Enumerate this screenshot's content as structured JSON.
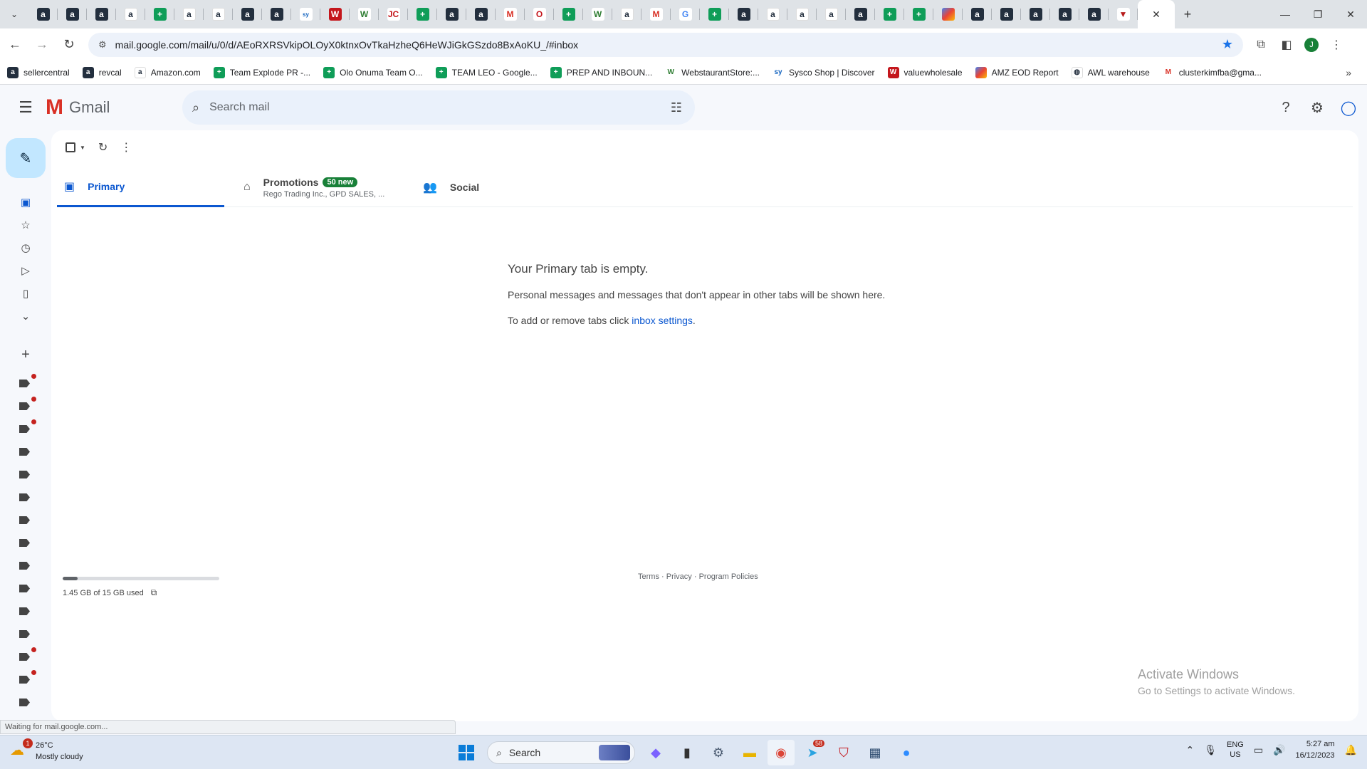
{
  "browser": {
    "tabs": [
      {
        "icon": "amazon-dark-icon",
        "glyph": "a",
        "style": "fav-amzd"
      },
      {
        "icon": "amazon-dark-icon",
        "glyph": "a",
        "style": "fav-amzd"
      },
      {
        "icon": "amazon-dark-icon",
        "glyph": "a",
        "style": "fav-amzd"
      },
      {
        "icon": "amazon-icon",
        "glyph": "a",
        "style": "fav-amz"
      },
      {
        "icon": "sheets-icon",
        "glyph": "+",
        "style": "fav-sheet"
      },
      {
        "icon": "amazon-icon",
        "glyph": "a",
        "style": "fav-amz"
      },
      {
        "icon": "amazon-icon",
        "glyph": "a",
        "style": "fav-amz"
      },
      {
        "icon": "amazon-dark-icon",
        "glyph": "a",
        "style": "fav-amzd"
      },
      {
        "icon": "amazon-dark-icon",
        "glyph": "a",
        "style": "fav-amzd"
      },
      {
        "icon": "sysco-icon",
        "glyph": "sy",
        "style": "fav-sys"
      },
      {
        "icon": "valuewholesale-icon",
        "glyph": "W",
        "style": "fav-w"
      },
      {
        "icon": "webstaurant-icon",
        "glyph": "W",
        "style": "fav-ws"
      },
      {
        "icon": "jc-icon",
        "glyph": "JC",
        "style": "fav-red"
      },
      {
        "icon": "sheets-icon",
        "glyph": "+",
        "style": "fav-sheet"
      },
      {
        "icon": "amazon-dark-icon",
        "glyph": "a",
        "style": "fav-amzd"
      },
      {
        "icon": "amazon-dark-icon",
        "glyph": "a",
        "style": "fav-amzd"
      },
      {
        "icon": "gmail-icon",
        "glyph": "M",
        "style": "fav-gm"
      },
      {
        "icon": "depot-icon",
        "glyph": "O",
        "style": "fav-red"
      },
      {
        "icon": "sheets-icon",
        "glyph": "+",
        "style": "fav-sheet"
      },
      {
        "icon": "webstaurant-icon",
        "glyph": "W",
        "style": "fav-ws"
      },
      {
        "icon": "amazon-icon",
        "glyph": "a",
        "style": "fav-amz"
      },
      {
        "icon": "gmail-icon",
        "glyph": "M",
        "style": "fav-gm"
      },
      {
        "icon": "google-icon",
        "glyph": "G",
        "style": "fav-g"
      },
      {
        "icon": "sheets-icon",
        "glyph": "+",
        "style": "fav-sheet"
      },
      {
        "icon": "amazon-dark-icon",
        "glyph": "a",
        "style": "fav-amzd"
      },
      {
        "icon": "amazon-icon",
        "glyph": "a",
        "style": "fav-amz"
      },
      {
        "icon": "amazon-icon",
        "glyph": "a",
        "style": "fav-amz"
      },
      {
        "icon": "amazon-icon",
        "glyph": "a",
        "style": "fav-amz"
      },
      {
        "icon": "amazon-dark-icon",
        "glyph": "a",
        "style": "fav-amzd"
      },
      {
        "icon": "sheets-icon",
        "glyph": "+",
        "style": "fav-sheet"
      },
      {
        "icon": "sheets-icon",
        "glyph": "+",
        "style": "fav-sheet"
      },
      {
        "icon": "multicolor-icon",
        "glyph": "",
        "style": "fav-multi"
      },
      {
        "icon": "amazon-dark-icon",
        "glyph": "a",
        "style": "fav-amzd"
      },
      {
        "icon": "amazon-dark-icon",
        "glyph": "a",
        "style": "fav-amzd"
      },
      {
        "icon": "amazon-dark-icon",
        "glyph": "a",
        "style": "fav-amzd"
      },
      {
        "icon": "amazon-dark-icon",
        "glyph": "a",
        "style": "fav-amzd"
      },
      {
        "icon": "amazon-dark-icon",
        "glyph": "a",
        "style": "fav-amzd"
      },
      {
        "icon": "triangle-icon",
        "glyph": "▼",
        "style": "fav-tri"
      }
    ],
    "active_tab_close": "✕",
    "new_tab": "+",
    "url": "mail.google.com/mail/u/0/d/AEoRXRSVkipOLOyX0ktnxOvTkaHzheQ6HeWJiGkGSzdo8BxAoKU_/#inbox",
    "profile_initial": "J",
    "bookmarks": [
      {
        "label": "sellercentral",
        "glyph": "a",
        "style": "fav-amzd",
        "icon": "amazon-dark-icon"
      },
      {
        "label": "revcal",
        "glyph": "a",
        "style": "fav-amzd",
        "icon": "amazon-dark-icon"
      },
      {
        "label": "Amazon.com",
        "glyph": "a",
        "style": "fav-amz",
        "icon": "amazon-icon"
      },
      {
        "label": "Team Explode PR -...",
        "glyph": "+",
        "style": "fav-sheet",
        "icon": "sheets-icon"
      },
      {
        "label": "Olo Onuma Team O...",
        "glyph": "+",
        "style": "fav-sheet",
        "icon": "sheets-icon"
      },
      {
        "label": "TEAM LEO - Google...",
        "glyph": "+",
        "style": "fav-sheet",
        "icon": "sheets-icon"
      },
      {
        "label": "PREP AND INBOUN...",
        "glyph": "+",
        "style": "fav-sheet",
        "icon": "sheets-icon"
      },
      {
        "label": "WebstaurantStore:...",
        "glyph": "W",
        "style": "fav-ws",
        "icon": "webstaurant-icon"
      },
      {
        "label": "Sysco Shop | Discover",
        "glyph": "sy",
        "style": "fav-sys",
        "icon": "sysco-icon"
      },
      {
        "label": "valuewholesale",
        "glyph": "W",
        "style": "fav-w",
        "icon": "valuewholesale-icon"
      },
      {
        "label": "AMZ EOD Report",
        "glyph": "",
        "style": "fav-multi",
        "icon": "multicolor-icon"
      },
      {
        "label": "AWL warehouse",
        "glyph": "◍",
        "style": "fav-amz",
        "icon": "globe-icon"
      },
      {
        "label": "clusterkimfba@gma...",
        "glyph": "M",
        "style": "fav-gm",
        "icon": "gmail-icon"
      }
    ]
  },
  "gmail": {
    "logo_text": "Gmail",
    "search_placeholder": "Search mail",
    "categories": {
      "primary": "Primary",
      "promotions": "Promotions",
      "promotions_badge": "50 new",
      "promotions_senders": "Rego Trading Inc., GPD SALES, ...",
      "social": "Social"
    },
    "empty": {
      "title": "Your Primary tab is empty.",
      "line1": "Personal messages and messages that don't appear in other tabs will be shown here.",
      "line2_prefix": "To add or remove tabs click ",
      "line2_link": "inbox settings",
      "line2_suffix": "."
    },
    "storage": {
      "text": "1.45 GB of 15 GB used",
      "used_fraction": 0.097
    },
    "footer": {
      "terms": "Terms",
      "privacy": "Privacy",
      "policies": "Program Policies",
      "sep": " · "
    }
  },
  "status_text": "Waiting for mail.google.com...",
  "watermark": {
    "line1": "Activate Windows",
    "line2": "Go to Settings to activate Windows."
  },
  "taskbar": {
    "weather_temp": "26°C",
    "weather_desc": "Mostly cloudy",
    "weather_badge": "1",
    "search_label": "Search",
    "telegram_badge": "58",
    "lang_top": "ENG",
    "lang_bottom": "US",
    "time": "5:27 am",
    "date": "16/12/2023"
  }
}
